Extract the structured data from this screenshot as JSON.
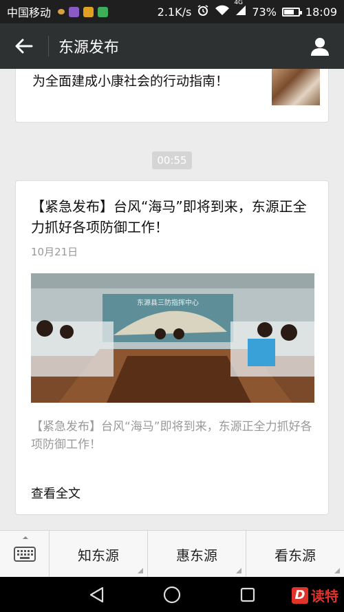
{
  "status_bar": {
    "carrier": "中国移动",
    "speed": "2.1K/s",
    "network": "4G",
    "battery_text": "73%",
    "battery_level": 0.73,
    "time": "18:09"
  },
  "title_bar": {
    "title": "东源发布",
    "back_icon": "arrow-left-icon",
    "profile_icon": "person-icon"
  },
  "prev_card": {
    "text": "【聚焦东源党代会】让县委工作报告成为全面建成小康社会的行动指南！"
  },
  "time_chip": "00:55",
  "article": {
    "title": "【紧急发布】台风“海马”即将到来，东源正全力抓好各项防御工作！",
    "date": "10月21日",
    "summary": "【紧急发布】台风“海马”即将到来，东源正全力抓好各项防御工作！",
    "read_all": "查看全文",
    "photo_caption": "东源县三防指挥中心"
  },
  "menu": {
    "keyboard_icon": "keyboard-icon",
    "items": [
      "知东源",
      "惠东源",
      "看东源"
    ]
  },
  "navbar": {
    "icons": [
      "back-triangle-icon",
      "home-circle-icon",
      "recent-square-icon"
    ]
  },
  "watermark": {
    "letter": "D",
    "text": "读特"
  },
  "colors": {
    "title_bar": "#2e3132",
    "background": "#ececec",
    "watermark": "#e0342a"
  }
}
